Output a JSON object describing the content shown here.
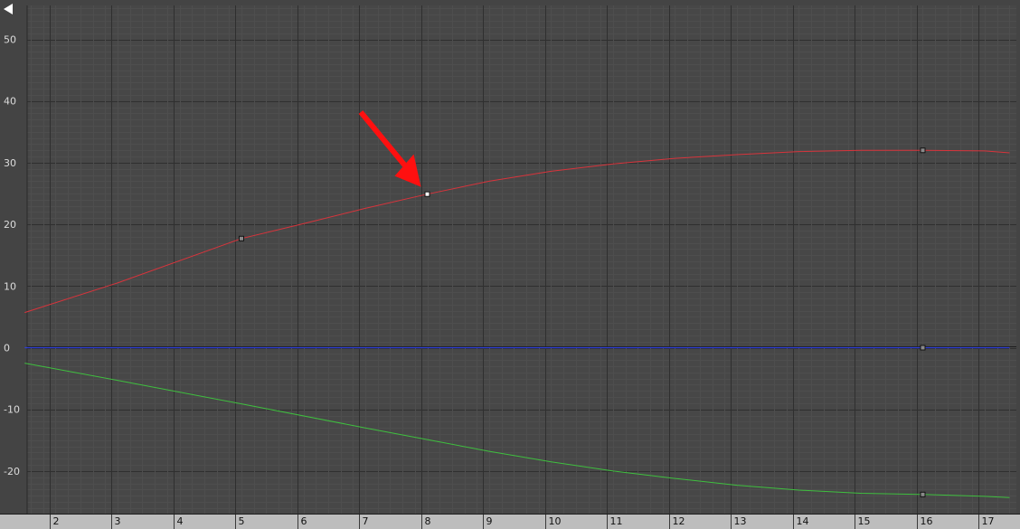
{
  "colors": {
    "background": "#444444",
    "plot_bg": "#474747",
    "grid_minor": "#4e4e4e",
    "grid_major": "#2f2f2f",
    "ruler_bg": "#bdbdbd",
    "curve_x": "#d8343c",
    "curve_y": "#3fbf3f",
    "curve_z": "#2f3fd6",
    "key": "#8a8a8a",
    "key_selected": "#ffffff",
    "annotation_arrow": "#ff1010"
  },
  "icons": {
    "collapse": "triangle-left-icon"
  },
  "chart_data": {
    "type": "line",
    "x_range": [
      1.5,
      17.4
    ],
    "y_range": [
      -26,
      55
    ],
    "y_ticks": [
      50,
      40,
      30,
      20,
      10,
      0,
      -10,
      -20
    ],
    "x_ticks": [
      2,
      3,
      4,
      5,
      6,
      7,
      8,
      9,
      10,
      11,
      12,
      13,
      14,
      15,
      16,
      17
    ],
    "grid": true,
    "series": [
      {
        "id": "x",
        "color": "#d8343c",
        "x": [
          1.5,
          3,
          5,
          6,
          7,
          8,
          9,
          10,
          11,
          12,
          13,
          14,
          15,
          16,
          17,
          17.4
        ],
        "y": [
          5.7,
          10.5,
          17.7,
          20.1,
          22.6,
          24.9,
          27.0,
          28.6,
          29.8,
          30.7,
          31.3,
          31.8,
          32.0,
          32.0,
          31.9,
          31.6
        ],
        "keys": [
          {
            "x": 5,
            "y": 17.7,
            "selected": false
          },
          {
            "x": 8,
            "y": 24.9,
            "selected": true
          },
          {
            "x": 16,
            "y": 32.0,
            "selected": false
          }
        ]
      },
      {
        "id": "y",
        "color": "#3fbf3f",
        "x": [
          1.5,
          3,
          5,
          7,
          8,
          9,
          10,
          11,
          12,
          13,
          14,
          15,
          16,
          17,
          17.4
        ],
        "y": [
          -2.5,
          -5.3,
          -9.1,
          -13.0,
          -14.9,
          -16.8,
          -18.5,
          -20.0,
          -21.2,
          -22.3,
          -23.1,
          -23.6,
          -23.8,
          -24.1,
          -24.3
        ],
        "keys": [
          {
            "x": 16,
            "y": -23.8,
            "selected": false
          }
        ]
      },
      {
        "id": "z",
        "color": "#2f3fd6",
        "x": [
          1.5,
          17.4
        ],
        "y": [
          0,
          0
        ],
        "keys": [
          {
            "x": 16,
            "y": 0,
            "selected": false
          }
        ]
      }
    ],
    "annotation": {
      "type": "arrow",
      "color": "#ff1010",
      "target": {
        "x": 8,
        "y": 24.9
      }
    }
  }
}
